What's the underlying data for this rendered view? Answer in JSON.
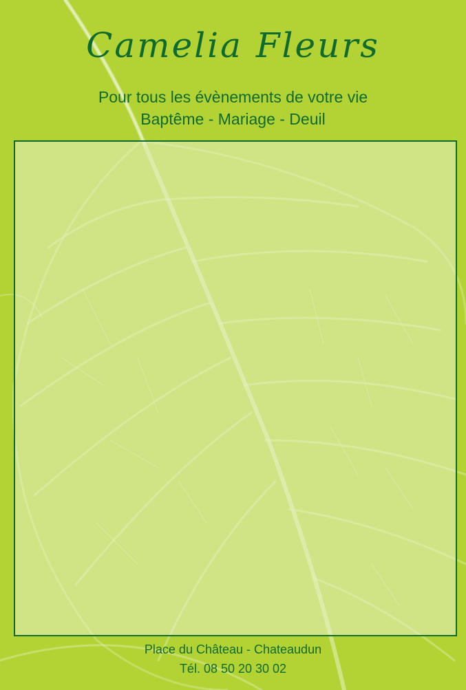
{
  "header": {
    "title": "Camelia Fleurs",
    "tagline_line1": "Pour tous les évènements de votre vie",
    "tagline_line2": "Baptême - Mariage - Deuil"
  },
  "footer": {
    "address": "Place du Château - Chateaudun",
    "phone": "Tél. 08 50 20 30 02"
  },
  "colors": {
    "background": "#b3d334",
    "text": "#0f6a2e",
    "panel_border": "#0f6a2e",
    "leaf_veins": "#e6f2c4"
  },
  "icons": {
    "background": "leaf-skeleton-illustration"
  }
}
